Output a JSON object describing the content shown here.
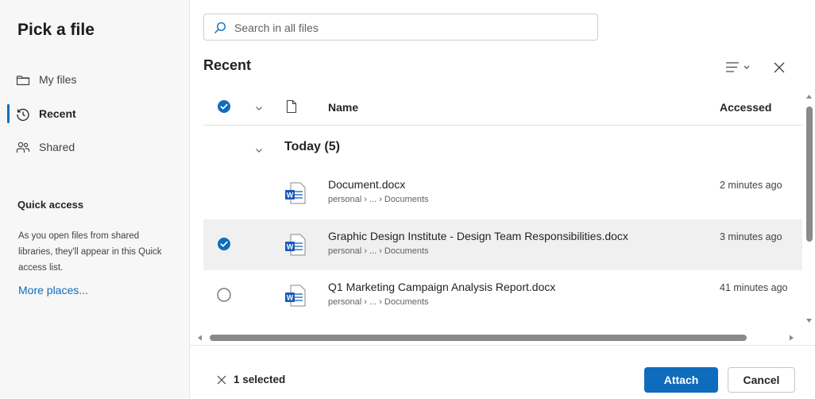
{
  "sidebar": {
    "title": "Pick a file",
    "items": [
      {
        "label": "My files",
        "icon": "folder-icon"
      },
      {
        "label": "Recent",
        "icon": "history-icon",
        "active": true
      },
      {
        "label": "Shared",
        "icon": "people-icon"
      }
    ],
    "quick_access": {
      "title": "Quick access",
      "description": "As you open files from shared libraries, they'll appear in this Quick access list.",
      "more_link": "More places..."
    }
  },
  "search": {
    "placeholder": "Search in all files",
    "value": ""
  },
  "main": {
    "section_title": "Recent",
    "columns": {
      "name": "Name",
      "accessed": "Accessed"
    },
    "group": {
      "label": "Today (5)"
    },
    "files": [
      {
        "name": "Document.docx",
        "path": "personal › ... › Documents",
        "accessed": "2 minutes ago",
        "selected": false,
        "icon": "word-file-icon"
      },
      {
        "name": "Graphic Design Institute - Design Team Responsibilities.docx",
        "path": "personal › ... › Documents",
        "accessed": "3 minutes ago",
        "selected": true,
        "icon": "word-file-icon"
      },
      {
        "name": "Q1 Marketing Campaign Analysis Report.docx",
        "path": "personal › ... › Documents",
        "accessed": "41 minutes ago",
        "selected": false,
        "icon": "word-file-icon"
      }
    ]
  },
  "footer": {
    "selected_count": "1 selected",
    "attach_label": "Attach",
    "cancel_label": "Cancel"
  },
  "colors": {
    "accent": "#0f6cbd",
    "selected_row": "#f0f0f0",
    "sidebar_bg": "#f7f7f7"
  }
}
